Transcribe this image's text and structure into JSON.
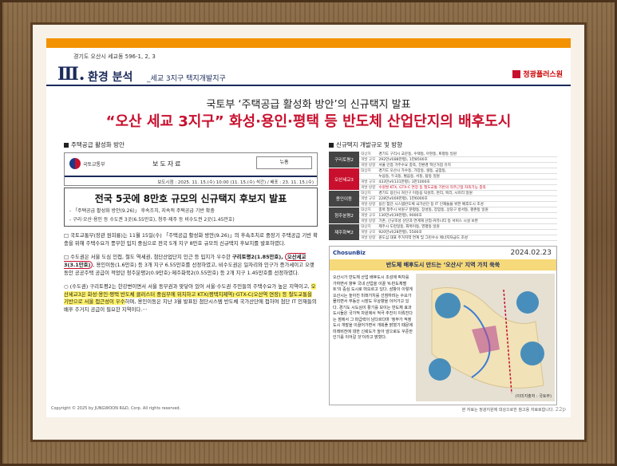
{
  "header": {
    "location_small": "경기도 오산시 세교동 596-1, 2, 3",
    "roman": "Ⅲ.",
    "title": "환경 분석",
    "subtitle": "_세교 3지구 택지개발지구",
    "logo_text": "정광플러스원"
  },
  "subtitle": "국토부 ‘주택공급 활성화 방안’의 신규택지 발표",
  "headline": "“오산 세교 3지구” 화성·용인·평택 등 반도체 산업단지의 배후도시",
  "doc": {
    "section_label": "주택공급 활성화 방안",
    "press_org": "국토교통부",
    "press_title": "보도자료",
    "press_stamp": "뉴홈",
    "press_release": "보도시점 : 2025. 11. 15.(수) 10:00 (11. 15.(수) 석간) / 배포 : 23. 11. 15.(수)",
    "big_title": "전국 5곳에 8만호 규모의 신규택지 후보지 발표",
    "bullet1": "- 「주택공급 활성화 방안(9.26)」 후속조치, 지속적 주택공급 기반 확충",
    "bullet2": "- 구리·오산·용인 등 수도권 3곳(6.55만호), 청주·제주 등 비수도권 2곳(1.45만호)",
    "para1": "□ 국토교통부(장관 원희룡)는 11월 15일(수) 「주택공급 활성화 방안(9.26)」의 후속조치로 중장기 주택공급 기반 확충을 위해 주택수요가 풍부한 입지 중심으로 전국 5개 지구 8만호 규모의 신규택지 후보지를 발표하였다.",
    "para2_a": "□ 수도권은 서울 도심 인접, 철도 역세권, 첨단산업단지 인근 등 입지가 우수한 ",
    "para2_b": "구리토평2(1.85만호), ",
    "para2_c": "오산세교3(3.1만호)",
    "para2_d": ", 용인이동(1.6만호) 등 3개 지구 6.55만호를 선정하였고, 비수도권은 일자리와 인구가 증가세이고 오랫동안 공공주택 공급이 적었던 청주분평2(0.9만호)·제주화북2(0.55만호) 등 2개 지구 1.45만호를 선정하였다.",
    "para3_a": "○ (수도권) 구리토평2는 한강변이면서 서울 동부권과 맞닿아 있어 서울·수도권 주민들의 주택수요가 높은 지역이고, ",
    "para3_b": "오산세교3은 화성·용인·평택 반도체 클러스터 중심부에 위치하고 KTX(평택지제역)·GTX-C(오산역 연장) 등 철도교통을 기반으로 서울 접근성이 우수",
    "para3_c": "하며, 용인이동은 지난 3월 발표된 첨단시스템 반도체 국가산단에 접하여 첨단 IT 인재들의 배후 주거지 공급이 필요한 지역이다.···"
  },
  "right": {
    "section_label": "신규택지 개발규모 및 방향",
    "rows": [
      {
        "group": "구리토평2",
        "red": false,
        "lines": [
          [
            "대상지",
            "경기도 구리시 교문동, 수택동, 아천동, 토평동 일원"
          ],
          [
            "개발 규모",
            "292만㎡(88만평), 1만8500호"
          ],
          [
            "개발 방향",
            "서울 인접 거주수요 충족, 친환경 혁신거점 유치"
          ]
        ]
      },
      {
        "group": "오산세교3",
        "red": true,
        "lines": [
          [
            "대상지",
            "경기도 오산시 가수동, 가장동, 궐동, 금암동,"
          ],
          [
            "",
            "누읍동, 두곡동, 벌음동, 서동, 탑동 일원"
          ],
          [
            "개발 규모",
            "433만㎡(131만평), 3만1000호"
          ],
          [
            "개발 방향",
            "수원발 KTX, GTX-C 연장 등 철도교통 기반의 직주근접 자족기능 충족"
          ]
        ]
      },
      {
        "group": "용인이동",
        "red": false,
        "lines": [
          [
            "대상지",
            "경기도 용인시 처인구 이동읍 덕성리, 천리, 묵리, 시미리 일원"
          ],
          [
            "개발 규모",
            "228만㎡(69만평), 1만6000호"
          ],
          [
            "개발 방향",
            "용인 첨단 시스템반도체 국가산단 등 IT 인재들을 위한 배후도시 조성"
          ]
        ]
      },
      {
        "group": "청주분평2",
        "red": false,
        "lines": [
          [
            "대상지",
            "충북 청주시 서원구 분평동, 장성동, 장암동, 상당구 방서동, 평촌동 일원"
          ],
          [
            "개발 규모",
            "130만㎡(39만평), 9000호"
          ],
          [
            "개발 방향",
            "기존, 신규조성 산단과 연계해 산업·커뮤니티 등 서비스 시설 보완"
          ]
        ]
      },
      {
        "group": "제주화북2",
        "red": false,
        "lines": [
          [
            "대상지",
            "제주시 도련일동, 화북이동, 영평동 일원"
          ],
          [
            "개발 규모",
            "920만㎡(28만평), 5500호"
          ],
          [
            "개발 방향",
            "원도심 대표 주거지역 연계 및 그린수소 에너지자급도 조성"
          ]
        ]
      }
    ],
    "news_brand": "ChosunBiz",
    "news_date": "2024.02.23",
    "news_banner": "반도체 배후도시 만드는 ‘오산시’ 지역 가치 쑥쑥",
    "news_text": "오산시가 반도체 산업 배후도시 조성에 박차를 가하면서 향후 국내 산업을 이끌 'K-반도체벨트'의 중심 도시로 떠오르고 있다. 삼항이 이렇게 오산시는 높아진 미래가치를 선점하려는 수요가 몰리면서 부동산 시장도 우상향을 이어가고 있다. 경기도 시도심이 활기를 보이는 반도체 효과 도시들은 국가적 차원에서 적극 추진이 이뤄진다는 점에서 그 파급력이 남다르다며 '정부가 적정 도시 개발을 이끌어가면서 개희플 밝혔기 때문에 미래비전에 대한 신뢰도가 높아 앞으로도 꾸준한 인기를 이어갈 것'이라고 밝혔다.",
    "map_caption": "(이미지출처 : 국토부)"
  },
  "footer": {
    "left": "Copyright © 2025 by JUNGWOON R&D, Corp. All rights reserved.",
    "right": "본 자료는 정광지원에 대상으로한 참고용 자료로합니다.",
    "page": "22p"
  },
  "colors": {
    "accent": "#c8102e",
    "orange": "#f39200",
    "navy": "#1a2a5a"
  }
}
